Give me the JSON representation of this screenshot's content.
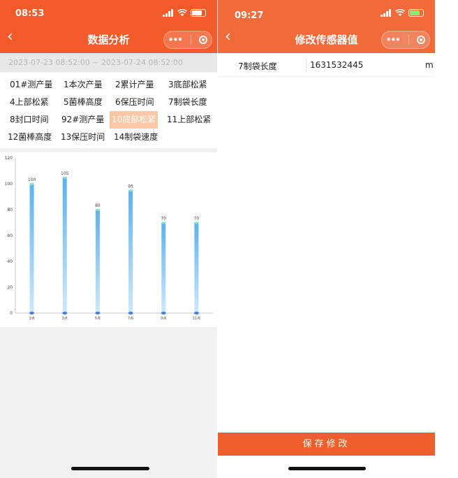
{
  "left": {
    "status_time": "08:53",
    "title": "数据分析",
    "date_range": "2023-07-23 08:52:00 ~ 2023-07-24 08:52:00",
    "sensors": [
      "01#测产量",
      "1本次产量",
      "2累计产量",
      "3底部松紧",
      "4上部松紧",
      "5菌棒高度",
      "6保压时间",
      "7制袋长度",
      "8封口时间",
      "92#测产量",
      "10底部松紧",
      "11上部松紧",
      "12菌棒高度",
      "13保压时间",
      "14制袋速度"
    ],
    "active_sensor_index": 10
  },
  "chart_data": {
    "type": "bar",
    "categories": [
      "1点",
      "3点",
      "5点",
      "7点",
      "9点",
      "11点"
    ],
    "values": [
      100,
      105,
      80,
      95,
      70,
      70
    ],
    "yticks": [
      0,
      20,
      40,
      60,
      80,
      100,
      120
    ],
    "ylim": [
      0,
      120
    ],
    "data_labels": true,
    "grid": false,
    "colors": {
      "bar_top": "#5bb1ef",
      "bar_bottom": "#cfe8fb",
      "cap": "#7fe2cf",
      "dot": "#3f7fe0"
    }
  },
  "right": {
    "status_time": "09:27",
    "title": "修改传感器值",
    "field_label": "7制袋长度",
    "field_value": "1631532445",
    "field_unit": "m",
    "save_label": "保存修改"
  },
  "colors": {
    "accent": "#f35a2a",
    "save": "#ee5f2b",
    "active_chip": "#f9c6a6"
  }
}
